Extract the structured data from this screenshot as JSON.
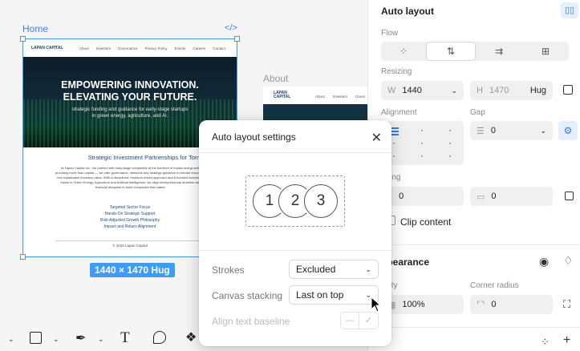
{
  "canvas": {
    "home_label": "Home",
    "about_label": "About",
    "code_icon": "</>",
    "size_badge": "1440 × 1470 Hug",
    "site": {
      "logo": "LAPAN CAPITAL",
      "nav_links": [
        "About",
        "Investors",
        "Governance",
        "Privacy Policy",
        "Events",
        "Careers",
        "Contact"
      ],
      "hero_title_1": "EMPOWERING INNOVATION.",
      "hero_title_2": "ELEVATING YOUR FUTURE.",
      "hero_sub_1": "strategic funding and guidance for early-stage startups",
      "hero_sub_2": "in green energy, agriculture, and AI.",
      "section_title": "Strategic Investment Partnerships for Tomorrow's Leaders",
      "paragraph": "At Lapan Capital Inc., we partner with early-stage companies at the forefront of impact and growth, providing more than capital — we offer governance, networks and strategic guidance to elevate innovation into sustainable business value. With a disciplined, research-driven approach and a focused investment thesis in Green Energy, Agriculture and Artificial Intelligence, we align entrepreneurial ambition with financial discipline to build companies that matter.",
      "links": [
        "Targeted Sector Focus",
        "Hands-On Strategic Support",
        "Risk-Adjusted Growth Philosophy",
        "Impact and Return Alignment"
      ],
      "footer": "© 2026 Lapan Capital"
    },
    "about_site": {
      "logo": "LAPAN CAPITAL",
      "nav_links": [
        "About",
        "Investors",
        "Gover"
      ]
    }
  },
  "toolbar": {
    "tools": [
      "move-tool",
      "frame-tool",
      "pen-tool",
      "text-tool",
      "comment-tool",
      "components-tool"
    ]
  },
  "panel": {
    "auto_layout_title": "Auto layout",
    "flow_label": "Flow",
    "resizing_label": "Resizing",
    "width_prefix": "W",
    "width_value": "1440",
    "height_prefix": "H",
    "height_value": "1470",
    "height_mode": "Hug",
    "alignment_label": "Alignment",
    "gap_label": "Gap",
    "gap_value": "0",
    "padding_label": "dding",
    "padding_h_value": "0",
    "padding_v_value": "0",
    "clip_content": "Clip content",
    "appearance_label": "ppearance",
    "opacity_label": "acity",
    "opacity_value": "100%",
    "corner_radius_label": "Corner radius",
    "corner_radius_value": "0"
  },
  "dialog": {
    "title": "Auto layout settings",
    "preview_items": [
      "1",
      "2",
      "3"
    ],
    "strokes_label": "Strokes",
    "strokes_value": "Excluded",
    "canvas_stacking_label": "Canvas stacking",
    "canvas_stacking_value": "Last on top",
    "align_baseline_label": "Align text baseline"
  },
  "colors": {
    "accent": "#3b9cff",
    "hero_dark": "#0c1c2a",
    "link_blue": "#1a4b8e"
  }
}
